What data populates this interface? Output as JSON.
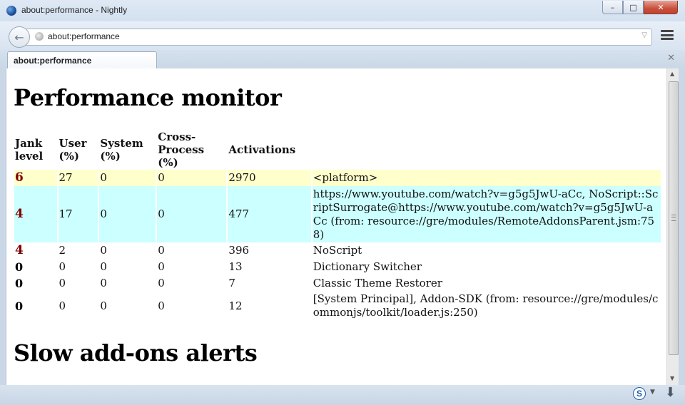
{
  "window": {
    "title": "about:performance - Nightly"
  },
  "navbar": {
    "url": "about:performance"
  },
  "tabs": [
    {
      "label": "about:performance"
    }
  ],
  "page": {
    "title": "Performance monitor",
    "headers": [
      "Jank level",
      "User (%)",
      "System (%)",
      "Cross-Process (%)",
      "Activations",
      ""
    ],
    "rows": [
      {
        "jank": "6",
        "user": "27",
        "system": "0",
        "cross": "0",
        "activations": "2970",
        "name": "<platform>",
        "highlight": "yellow"
      },
      {
        "jank": "4",
        "user": "17",
        "system": "0",
        "cross": "0",
        "activations": "477",
        "name": "https://www.youtube.com/watch?v=g5g5JwU-aCc, NoScript::ScriptSurrogate@https://www.youtube.com/watch?v=g5g5JwU-aCc (from: resource://gre/modules/RemoteAddonsParent.jsm:758)",
        "highlight": "cyan"
      },
      {
        "jank": "4",
        "user": "2",
        "system": "0",
        "cross": "0",
        "activations": "396",
        "name": "NoScript",
        "highlight": "none"
      },
      {
        "jank": "0",
        "user": "0",
        "system": "0",
        "cross": "0",
        "activations": "13",
        "name": "Dictionary Switcher",
        "highlight": "none"
      },
      {
        "jank": "0",
        "user": "0",
        "system": "0",
        "cross": "0",
        "activations": "7",
        "name": "Classic Theme Restorer",
        "highlight": "none"
      },
      {
        "jank": "0",
        "user": "0",
        "system": "0",
        "cross": "0",
        "activations": "12",
        "name": "[System Principal], Addon-SDK (from: resource://gre/modules/commonjs/toolkit/loader.js:250)",
        "highlight": "none"
      }
    ],
    "alerts_title": "Slow add-ons alerts"
  },
  "statusbar": {
    "noscript_letter": "S"
  }
}
